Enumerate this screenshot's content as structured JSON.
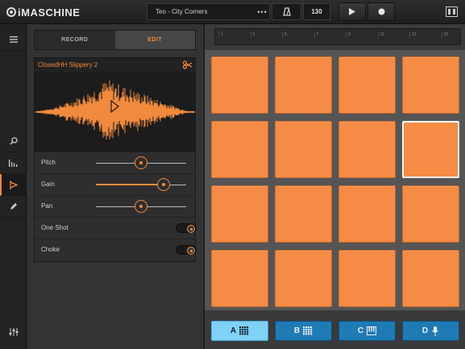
{
  "app": {
    "logo": "iMASCHINE",
    "project_name": "Teo - City Corners",
    "project_menu": "•••",
    "tempo": "130"
  },
  "tabs": {
    "record": "RECORD",
    "edit": "EDIT"
  },
  "sample": {
    "name": "ClosedHH Slippery 2"
  },
  "params": [
    {
      "label": "Pitch",
      "value": 0.5
    },
    {
      "label": "Gain",
      "value": 0.75
    },
    {
      "label": "Pan",
      "value": 0.5
    }
  ],
  "toggles": [
    {
      "label": "One Shot",
      "on": true
    },
    {
      "label": "Choke",
      "on": true
    }
  ],
  "timeline": {
    "ticks": [
      "1",
      "3",
      "5",
      "7",
      "9",
      "11",
      "13",
      "15"
    ]
  },
  "pads": {
    "count": 16,
    "selected_index": 7
  },
  "groups": [
    {
      "label": "A",
      "icon": "grid-icon",
      "active": true
    },
    {
      "label": "B",
      "icon": "grid-icon",
      "active": false
    },
    {
      "label": "C",
      "icon": "keyboard-icon",
      "active": false
    },
    {
      "label": "D",
      "icon": "microphone-icon",
      "active": false
    }
  ],
  "colors": {
    "accent": "#f08a3c",
    "pad": "#f58b44",
    "group": "#1f7bb5",
    "group_active": "#7fd1f5"
  }
}
